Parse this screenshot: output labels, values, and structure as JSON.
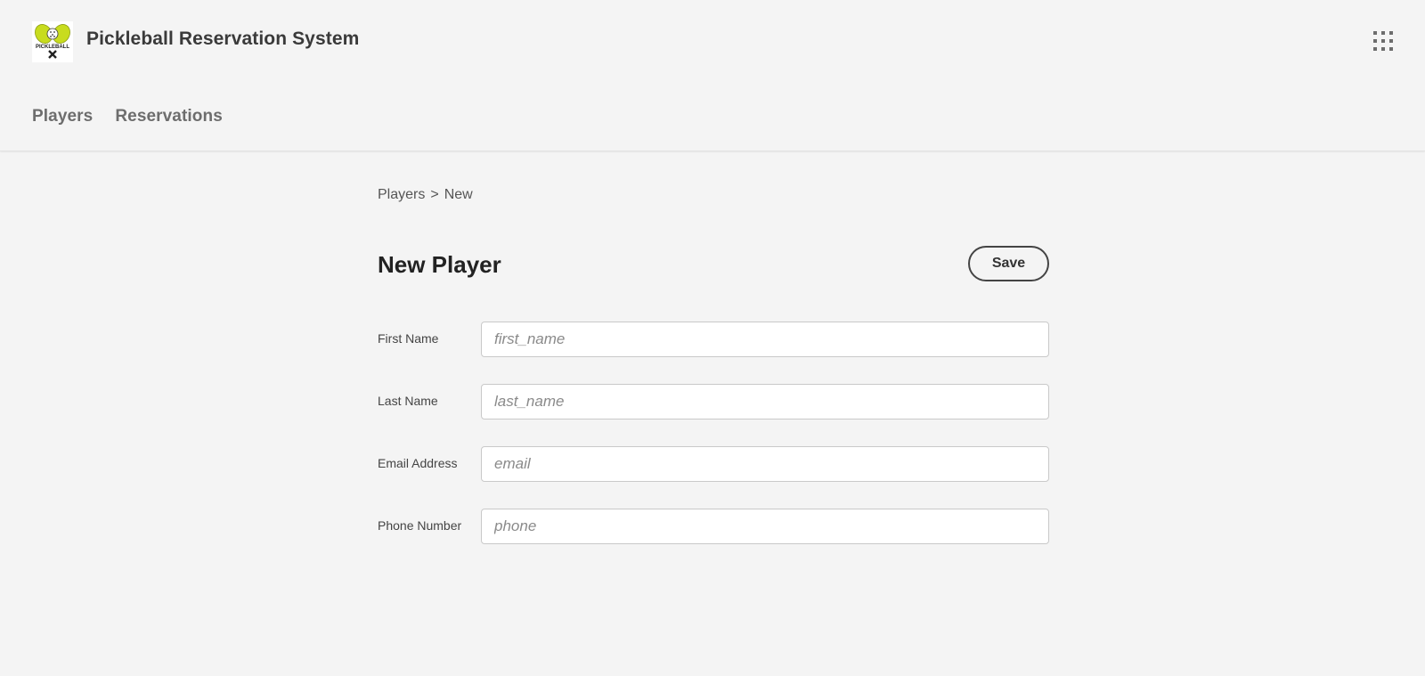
{
  "app": {
    "title": "Pickleball Reservation System",
    "logo_icon": "pickleball-paddles-logo",
    "logo_text": "PICKLEBALL",
    "apps_icon": "grid-icon"
  },
  "nav": {
    "items": [
      {
        "label": "Players"
      },
      {
        "label": "Reservations"
      }
    ]
  },
  "breadcrumb": {
    "parent": "Players",
    "separator": ">",
    "current": "New"
  },
  "page": {
    "title": "New Player",
    "save_label": "Save"
  },
  "form": {
    "fields": [
      {
        "label": "First Name",
        "placeholder": "first_name",
        "value": ""
      },
      {
        "label": "Last Name",
        "placeholder": "last_name",
        "value": ""
      },
      {
        "label": "Email Address",
        "placeholder": "email",
        "value": ""
      },
      {
        "label": "Phone Number",
        "placeholder": "phone",
        "value": ""
      }
    ]
  },
  "colors": {
    "background": "#f4f4f4",
    "logo_accent": "#c8dc1e",
    "text_dark": "#222222"
  }
}
